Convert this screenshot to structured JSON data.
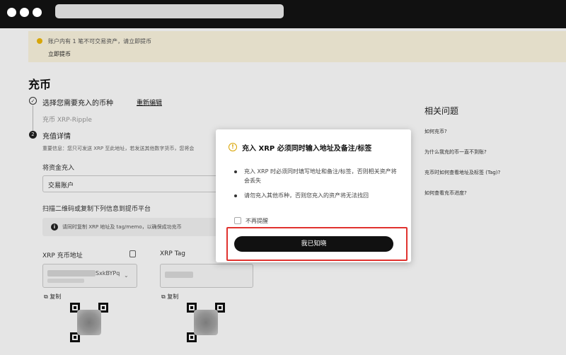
{
  "banner": {
    "text": "账户内有 1 笔不可交易资产，请立即提币",
    "link": "立即提币"
  },
  "page_title": "充币",
  "step1": {
    "number": "✓",
    "title": "选择您需要充入的币种",
    "edit_link": "重新编辑",
    "selected": "充币 XRP-Ripple"
  },
  "step2": {
    "number": "2",
    "title": "充值详情",
    "notice": "重要信息：您只可发送 XRP 至此地址，若发送其他数字货币，您将会"
  },
  "fund": {
    "label": "将资金充入",
    "value": "交易账户"
  },
  "scan_text": "扫描二维码或复制下列信息到提币平台",
  "info_bar": {
    "icon": "i",
    "text": "请同时复制 XRP 地址及 tag/memo，以确保成功充币"
  },
  "address": {
    "label": "XRP 充币地址",
    "value": "SxkBYPq",
    "copy": "复制"
  },
  "tag": {
    "label": "XRP Tag",
    "copy": "复制"
  },
  "faq": {
    "title": "相关问题",
    "items": [
      "如何充币?",
      "为什么我充的币一直不到账?",
      "充币时如何查看地址及标签 (Tag)?",
      "如何查看充币进度?"
    ]
  },
  "modal": {
    "icon": "!",
    "title": "充入 XRP 必须同时输入地址及备注/标签",
    "bullets": [
      "充入 XRP 时必须同时填写地址和备注/标签，否则相关资产将会丢失",
      "请勿充入其他币种，否则您充入的资产将无法找回"
    ],
    "checkbox_label": "不再提醒",
    "confirm_label": "我已知晓"
  },
  "colors": {
    "accent": "#f0b90b",
    "highlight": "#e0322e"
  }
}
